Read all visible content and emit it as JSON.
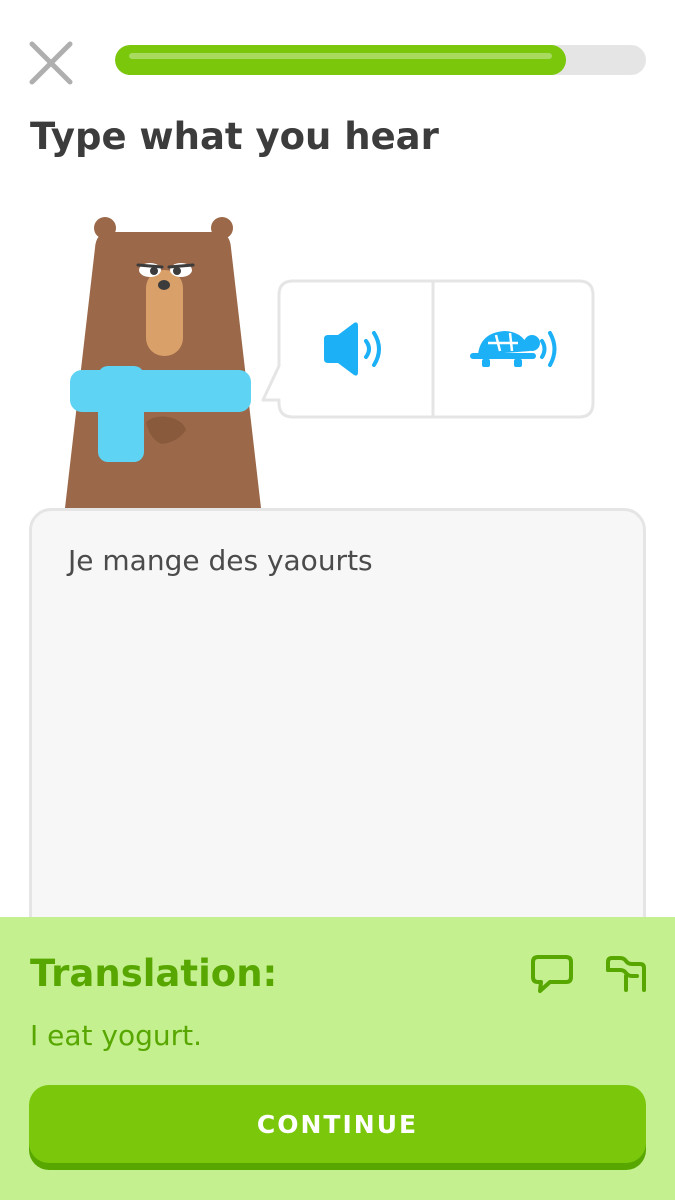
{
  "progress": {
    "value": 0.85,
    "color": "#7ac70c",
    "track_color": "#e5e5e5"
  },
  "header": {
    "close_icon": "close-icon"
  },
  "prompt": {
    "title": "Type what you hear"
  },
  "character": {
    "name_icon": "bear-character"
  },
  "audio": {
    "normal_icon": "speaker-icon",
    "slow_icon": "turtle-speaker-icon",
    "icon_color": "#1cb0f6"
  },
  "answer": {
    "text": "Je mange des yaourts"
  },
  "feedback": {
    "title": "Translation:",
    "translation": "I eat yogurt.",
    "discuss_icon": "comment-icon",
    "report_icon": "flag-icon",
    "panel_color": "#c4f08f",
    "text_color": "#58a700"
  },
  "continue_button": {
    "label": "CONTINUE",
    "color": "#7ac70c"
  }
}
